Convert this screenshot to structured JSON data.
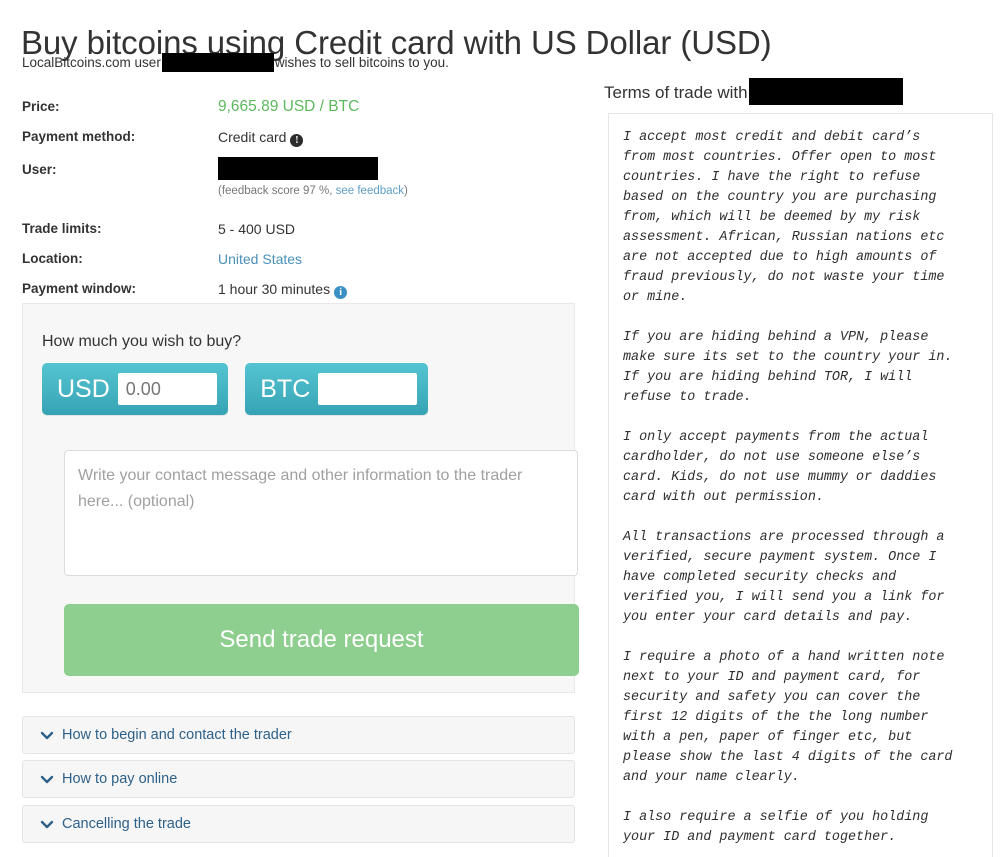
{
  "page": {
    "title": "Buy bitcoins using Credit card with US Dollar (USD)",
    "subtitle_before": "LocalBitcoins.com user",
    "subtitle_after": "wishes to sell bitcoins to you."
  },
  "details": {
    "price": {
      "label": "Price:",
      "value": "9,665.89 USD / BTC",
      "color": "#5cb85c"
    },
    "payment_method": {
      "label": "Payment method:",
      "value": "Credit card",
      "info_icon": "info-icon-dark"
    },
    "user": {
      "label": "User:",
      "value": "",
      "feedback_prefix": "(feedback score 97 %, ",
      "feedback_link": "see feedback",
      "feedback_suffix": ")"
    },
    "trade_limits": {
      "label": "Trade limits:",
      "value": "5 - 400 USD"
    },
    "location": {
      "label": "Location:",
      "value": "United States",
      "link_color": "#4a90b9"
    },
    "payment_window": {
      "label": "Payment window:",
      "value": "1 hour 30 minutes",
      "info_icon": "info-icon-blue"
    }
  },
  "buy_form": {
    "heading": "How much you wish to buy?",
    "usd": {
      "currency": "USD",
      "value": "",
      "placeholder": "0.00"
    },
    "btc": {
      "currency": "BTC",
      "value": "",
      "placeholder": ""
    },
    "message": {
      "value": "",
      "placeholder": "Write your contact message and other information to the trader here... (optional)"
    },
    "submit_label": "Send trade request",
    "submit_color": "#8ece8e"
  },
  "accordions": [
    {
      "label": "How to begin and contact the trader",
      "icon": "chevron-down-icon"
    },
    {
      "label": "How to pay online",
      "icon": "chevron-down-icon"
    },
    {
      "label": "Cancelling the trade",
      "icon": "chevron-down-icon"
    }
  ],
  "terms": {
    "header": "Terms of trade with",
    "paragraphs": [
      "I accept most credit and debit card’s\nfrom most countries. Offer open to most\ncountries. I have the right to refuse\nbased on the country you are purchasing\nfrom, which will be deemed by my risk\nassessment. African, Russian nations etc\nare not accepted due to high amounts of\nfraud previously, do not waste your time\nor mine.",
      "If you are hiding behind a VPN, please\nmake sure its set to the country your in.\nIf you are hiding behind TOR, I will\nrefuse to trade.",
      "I only accept payments from the actual\ncardholder, do not use someone else’s\ncard. Kids, do not use mummy or daddies\ncard with out permission.",
      "All transactions are processed through a\nverified, secure payment system. Once I\nhave completed security checks and\nverified you, I will send you a link for\nyou enter your card details and pay.",
      "I require a photo of a hand written note\nnext to your ID and payment card, for\nsecurity and safety you can cover the\nfirst 12 digits of the the long number\nwith a pen, paper of finger etc, but\nplease show the last 4 digits of the card\nand your name clearly.",
      "I also require a selfie of you holding\nyour ID and payment card together."
    ]
  }
}
